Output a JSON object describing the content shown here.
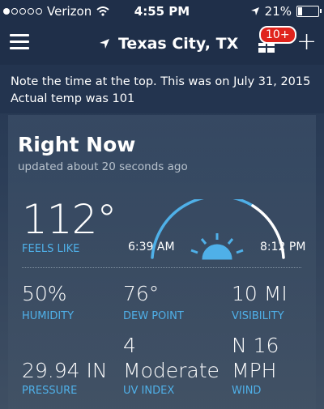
{
  "status_bar": {
    "carrier": "Verizon",
    "time": "4:55 PM",
    "battery": "21%"
  },
  "nav": {
    "location": "Texas City, TX",
    "badge": "10+"
  },
  "note": {
    "line1": "Note the time at the top. This was on July 31, 2015",
    "line2": "Actual temp was 101"
  },
  "right_now": {
    "title": "Right Now",
    "updated": "updated about 20 seconds ago",
    "temperature": "112°",
    "feels_like_label": "FEELS LIKE",
    "sunrise": "6:39 AM",
    "sunset": "8:12 PM",
    "stats": {
      "humidity": {
        "value": "50%",
        "label": "HUMIDITY"
      },
      "dew_point": {
        "value": "76°",
        "label": "DEW POINT"
      },
      "visibility": {
        "value": "10 MI",
        "label": "VISIBILITY"
      },
      "pressure": {
        "value": "29.94 IN",
        "label": "PRESSURE"
      },
      "uv_index": {
        "number": "4",
        "value": "Moderate",
        "label": "UV INDEX"
      },
      "wind": {
        "direction_speed": "N 16",
        "unit": "MPH",
        "label": "WIND"
      }
    }
  },
  "colors": {
    "accent_label": "#4fb0e8",
    "badge": "#e0231c",
    "arc_lit": "#4fb0e8",
    "arc_rest": "#ffffff"
  }
}
